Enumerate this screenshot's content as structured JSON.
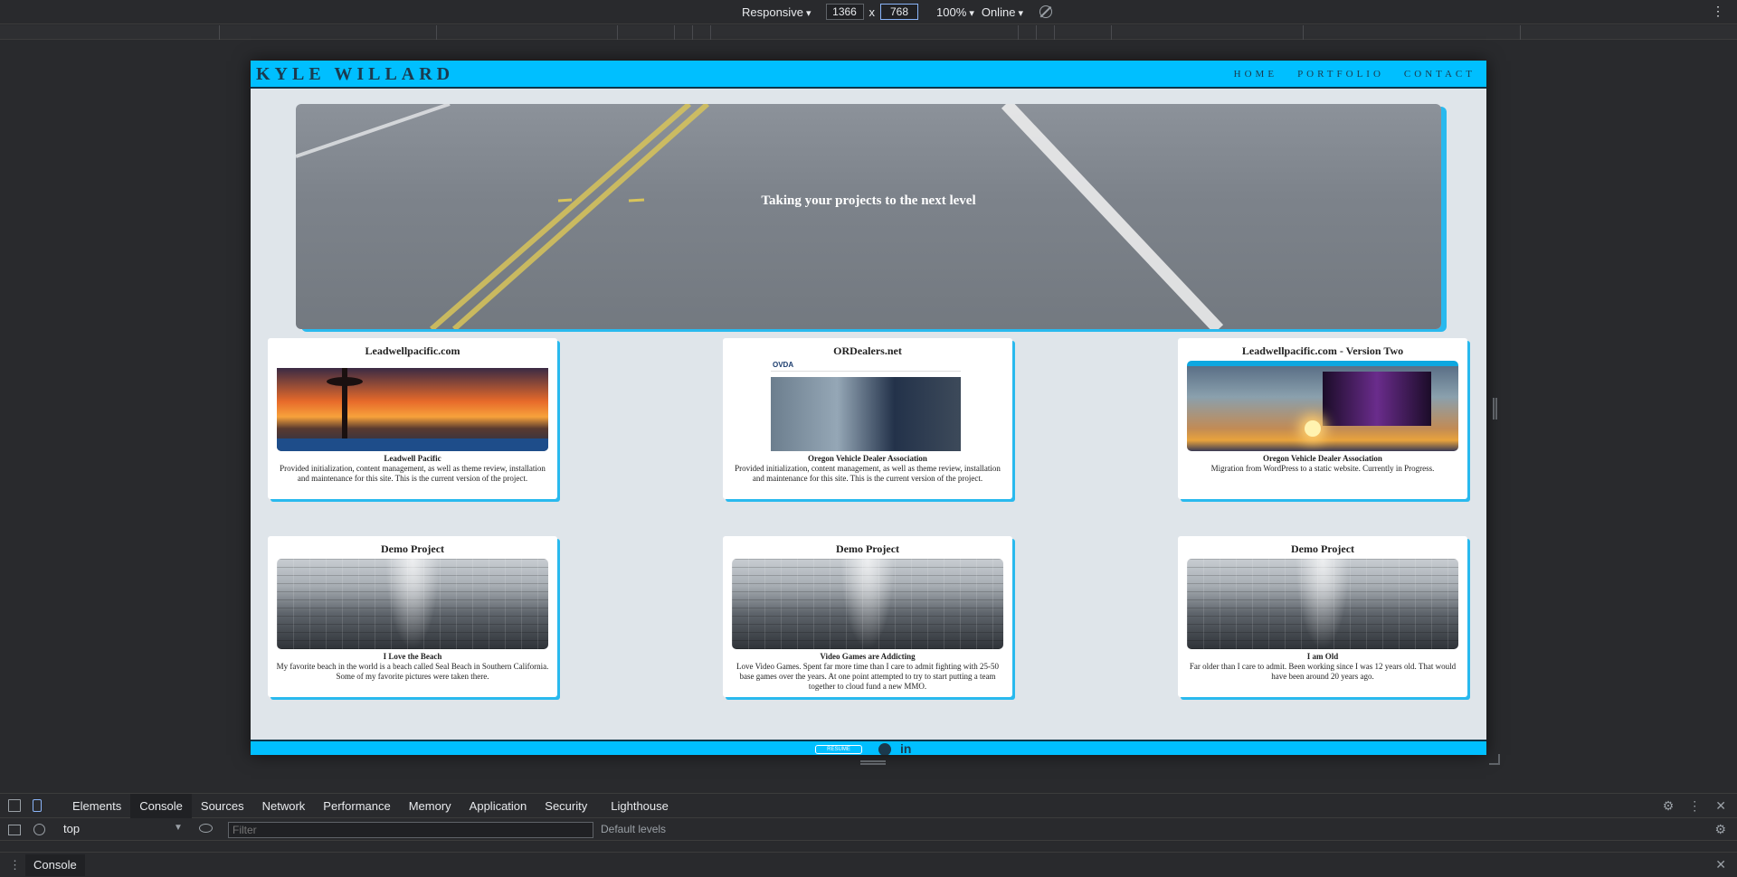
{
  "device_toolbar": {
    "mode": "Responsive",
    "width": "1366",
    "separator": "x",
    "height": "768",
    "zoom": "100%",
    "throttle": "Online"
  },
  "site": {
    "logo": "KYLE WILLARD",
    "nav": [
      "HOME",
      "PORTFOLIO",
      "CONTACT"
    ],
    "hero_text": "Taking your projects to the next level",
    "cards": [
      {
        "title": "Leadwellpacific.com",
        "subtitle": "Leadwell Pacific",
        "description": "Provided initialization, content management, as well as theme review, installation and maintenance for this site. This is the current version of the project.",
        "thumb": "sunset"
      },
      {
        "title": "ORDealers.net",
        "subtitle": "Oregon Vehicle Dealer Association",
        "description": "Provided initialization, content management, as well as theme review, installation and maintenance for this site. This is the current version of the project.",
        "thumb": "dealer"
      },
      {
        "title": "Leadwellpacific.com - Version Two",
        "subtitle": "Oregon Vehicle Dealer Association",
        "description": "Migration from WordPress to a static website. Currently in Progress.",
        "thumb": "v2"
      },
      {
        "title": "Demo Project",
        "subtitle": "I Love the Beach",
        "description": "My favorite beach in the world is a beach called Seal Beach in Southern California. Some of my favorite pictures were taken there.",
        "thumb": "building"
      },
      {
        "title": "Demo Project",
        "subtitle": "Video Games are Addicting",
        "description": "Love Video Games. Spent far more time than I care to admit fighting with 25-50 base games over the years. At one point attempted to try to start putting a team together to cloud fund a new MMO.",
        "thumb": "building"
      },
      {
        "title": "Demo Project",
        "subtitle": "I am Old",
        "description": "Far older than I care to admit. Been working since I was 12 years old. That would have been around 20 years ago.",
        "thumb": "building"
      }
    ],
    "thumb_logo": "OVDA",
    "footer": {
      "resume_label": "RESUME"
    },
    "colors": {
      "accent": "#00bfff",
      "page_bg": "#dfe5ea",
      "dark": "#1b3a4e"
    }
  },
  "devtools": {
    "tabs": [
      "Elements",
      "Console",
      "Sources",
      "Network",
      "Performance",
      "Memory",
      "Application",
      "Security",
      "Lighthouse"
    ],
    "active_tab": "Console",
    "context": "top",
    "filter_placeholder": "Filter",
    "levels": "Default levels",
    "drawer_tab": "Console"
  }
}
